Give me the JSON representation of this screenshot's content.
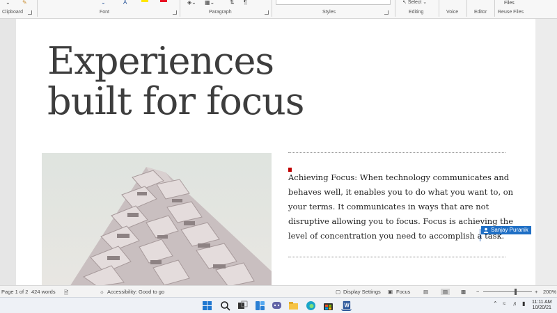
{
  "ribbon": {
    "groups": {
      "clipboard": "Clipboard",
      "font": "Font",
      "paragraph": "Paragraph",
      "styles": "Styles",
      "editing": "Editing",
      "voice": "Voice",
      "editor": "Editor",
      "reuse_files": "Reuse Files"
    },
    "select_label": "Select",
    "files_label": "Files",
    "colors": {
      "highlight": "#ffe600",
      "font_color": "#e81123",
      "accent": "#2b579a"
    }
  },
  "document": {
    "title_line1": "Experiences",
    "title_line2": "built for focus",
    "paragraph_lines": [
      "Achieving Focus: When technology communicates and",
      "behaves well, it enables you to do what you want to, on",
      "your terms. It communicates in ways that are not",
      "disruptive allowing you to focus. Focus is achieving the",
      "level of concentration you need to accomplish a task."
    ],
    "coauthor_name": "Sanjay Puranik"
  },
  "status_bar": {
    "page": "Page 1 of 2",
    "words": "424 words",
    "accessibility": "Accessibility: Good to go",
    "display_settings": "Display Settings",
    "focus": "Focus",
    "zoom": "200%"
  },
  "taskbar": {
    "date": "10/20/21",
    "time": "11:11 AM"
  }
}
